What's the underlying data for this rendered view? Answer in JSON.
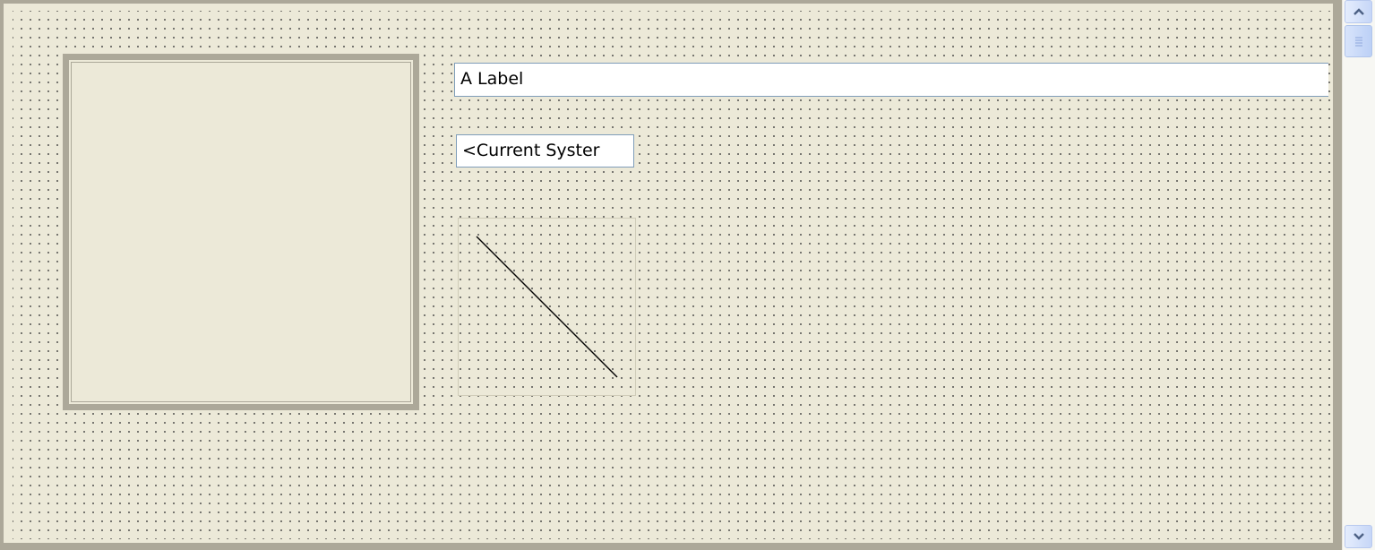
{
  "canvas": {
    "label_control": {
      "text": "A Label"
    },
    "system_control": {
      "text": "<Current Syster"
    }
  },
  "scrollbar": {
    "up_icon": "chevron-up-icon",
    "down_icon": "chevron-down-icon",
    "thumb_icon": "grip-icon"
  },
  "colors": {
    "background": "#ECE9D8",
    "frame_border": "#ACA899",
    "field_border": "#7F9DB9",
    "scroll_arrow": "#4D6185"
  }
}
